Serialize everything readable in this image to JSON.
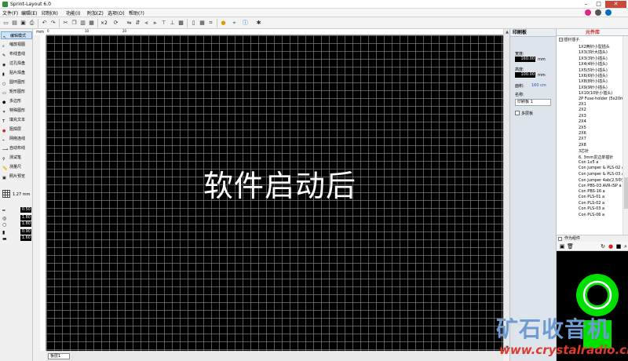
{
  "window": {
    "title": "Sprint-Layout 6.0"
  },
  "menu": [
    "文件(F)",
    "编辑(E)",
    "印制(R)",
    "功能(I)",
    "附加(Z)",
    "选项(O)",
    "帮助(?)"
  ],
  "toolbar": {
    "zoom": "×2"
  },
  "tools": [
    {
      "label": "编辑模式",
      "icon": "cursor-icon",
      "active": true
    },
    {
      "label": "缩放视图",
      "icon": "zoom-icon"
    },
    {
      "label": "布线直线",
      "icon": "pencil-icon"
    },
    {
      "label": "过孔焊盘",
      "icon": "via-pad-icon"
    },
    {
      "label": "贴片焊盘",
      "icon": "smd-pad-icon"
    },
    {
      "label": "圆环图形",
      "icon": "circle-icon"
    },
    {
      "label": "矩形图形",
      "icon": "rectangle-icon"
    },
    {
      "label": "多边形",
      "icon": "polygon-icon"
    },
    {
      "label": "特殊图形",
      "icon": "special-shape-icon"
    },
    {
      "label": "填充文本",
      "icon": "text-icon"
    },
    {
      "label": "阻焊层",
      "icon": "solder-mask-icon"
    },
    {
      "label": "网络连线",
      "icon": "net-icon"
    },
    {
      "label": "自动布线",
      "icon": "autoroute-icon"
    },
    {
      "label": "测试笔",
      "icon": "probe-icon"
    },
    {
      "label": "测量尺",
      "icon": "ruler-icon"
    },
    {
      "label": "照片预览",
      "icon": "photo-icon"
    }
  ],
  "grid": {
    "value": "1.27 mm"
  },
  "widths": [
    "0.50",
    "1.80",
    "1.80",
    "0.90",
    "1.60"
  ],
  "ruler": {
    "unit": "mm",
    "top_labels": [
      "0",
      "10",
      "20"
    ]
  },
  "canvas": {
    "caption": "软件启动后"
  },
  "layer_tab": "板层1",
  "properties": {
    "title": "印刷板",
    "width_label": "宽度:",
    "width_value": "160.00",
    "height_label": "高度:",
    "height_value": "100.00",
    "unit": "mm",
    "area_label": "面积:",
    "area_value": "160 cm",
    "name_label": "名称:",
    "name_value": "印刷板 1",
    "multilayer_label": "多层板"
  },
  "library": {
    "title": "元件库",
    "root": "插针插子",
    "items": [
      "1X2两针小型插头",
      "1X3(3针大插头)",
      "1X3(3针小插头)",
      "1X4(4针小插头)",
      "1X5(5针小插头)",
      "1X6(6针小插头)",
      "1X8(8针小插头)",
      "1X9(9针小插头)",
      "1X10(10针小插头)",
      "2P Fuse-holder (5x20mm)",
      "2X1",
      "2X2",
      "2X3",
      "2X4",
      "2X5",
      "2X6",
      "2X7",
      "2X8",
      "3芯针",
      "6, 3mm贯边单插针",
      "Con 1x5 a",
      "Con Jumper & PLS-02 a",
      "Con Jumper & PLS-03 a",
      "Con Jumper 4ab(2,5中) a",
      "Con PBS-03 AVR-ISP a",
      "Con PBS-16 a",
      "Con PLS-01 a",
      "Con PLS-02 a",
      "Con PLS-03 a",
      "Con PLS-06 a"
    ],
    "as_component": "作为组件"
  },
  "watermark": {
    "line1": "矿石收音机",
    "line2": "www.crystalradio.cn"
  },
  "colors": {
    "canvas": "#000000",
    "grid": "#787878",
    "pad": "#00e000",
    "close": "#c9483c"
  }
}
